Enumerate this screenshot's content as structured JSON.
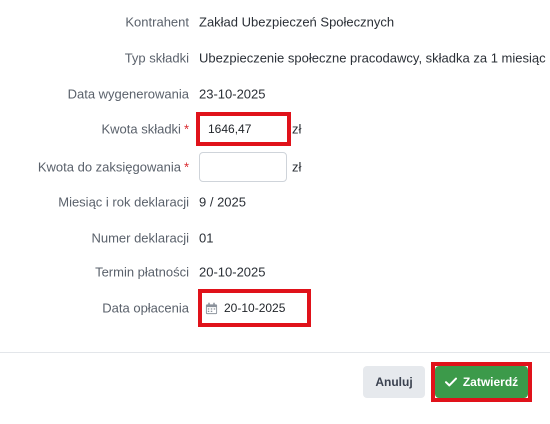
{
  "fields": {
    "contractor": {
      "label": "Kontrahent",
      "value": "Zakład Ubezpieczeń Społecznych"
    },
    "contribution_type": {
      "label": "Typ składki",
      "value": "Ubezpieczenie społeczne pracodawcy, składka za 1 miesiąc"
    },
    "generated_date": {
      "label": "Data wygenerowania",
      "value": "23-10-2025"
    },
    "contribution_amount": {
      "label": "Kwota składki",
      "required_mark": "*",
      "value": "1646,47",
      "unit": "zł"
    },
    "amount_to_post": {
      "label": "Kwota do zaksięgowania",
      "required_mark": "*",
      "value": "",
      "unit": "zł"
    },
    "declaration_month_year": {
      "label": "Miesiąc i rok deklaracji",
      "value": "9 / 2025"
    },
    "declaration_number": {
      "label": "Numer deklaracji",
      "value": "01"
    },
    "payment_deadline": {
      "label": "Termin płatności",
      "value": "20-10-2025"
    },
    "payment_date": {
      "label": "Data opłacenia",
      "value": "20-10-2025",
      "icon": "calendar-icon"
    }
  },
  "buttons": {
    "cancel": "Anuluj",
    "confirm": "Zatwierdź",
    "confirm_icon": "check-icon"
  },
  "colors": {
    "highlight": "#e0121a",
    "confirm_bg": "#3c9a4a",
    "cancel_bg": "#e6e9ed",
    "required": "#d9252b"
  }
}
